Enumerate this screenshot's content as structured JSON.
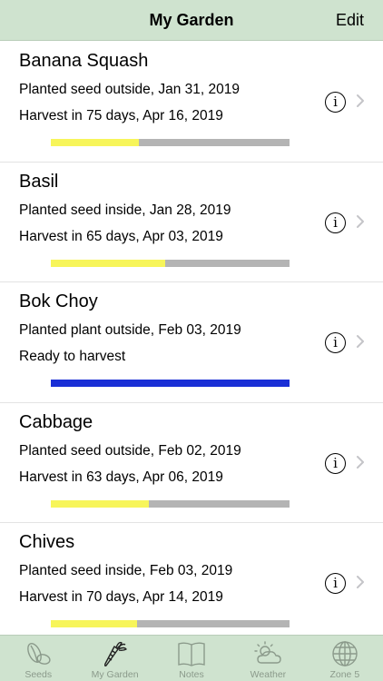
{
  "header": {
    "title": "My Garden",
    "edit_label": "Edit"
  },
  "plants": [
    {
      "name": "Banana Squash",
      "line1": "Planted seed outside, Jan 31, 2019",
      "line2": "Harvest in 75 days, Apr 16, 2019",
      "progress": 0.37,
      "progress_color": "#f7f55a"
    },
    {
      "name": "Basil",
      "line1": "Planted seed inside, Jan 28, 2019",
      "line2": "Harvest in 65 days, Apr 03, 2019",
      "progress": 0.48,
      "progress_color": "#f7f55a"
    },
    {
      "name": "Bok Choy",
      "line1": "Planted plant outside, Feb 03, 2019",
      "line2": "Ready to harvest",
      "progress": 1.0,
      "progress_color": "#1a2fd6"
    },
    {
      "name": "Cabbage",
      "line1": "Planted seed outside, Feb 02, 2019",
      "line2": "Harvest in 63 days, Apr 06, 2019",
      "progress": 0.41,
      "progress_color": "#f7f55a"
    },
    {
      "name": "Chives",
      "line1": "Planted seed inside, Feb 03, 2019",
      "line2": "Harvest in 70 days, Apr 14, 2019",
      "progress": 0.36,
      "progress_color": "#f7f55a"
    }
  ],
  "tabs": [
    {
      "label": "Seeds",
      "icon": "seeds-icon",
      "active": false
    },
    {
      "label": "My Garden",
      "icon": "carrot-icon",
      "active": true
    },
    {
      "label": "Notes",
      "icon": "notebook-icon",
      "active": false
    },
    {
      "label": "Weather",
      "icon": "weather-icon",
      "active": false
    },
    {
      "label": "Zone 5",
      "icon": "globe-icon",
      "active": false
    }
  ],
  "colors": {
    "bar_background": "#cfe3cf",
    "tab_active": "#b7d0b7",
    "track": "#b4b4b4"
  }
}
